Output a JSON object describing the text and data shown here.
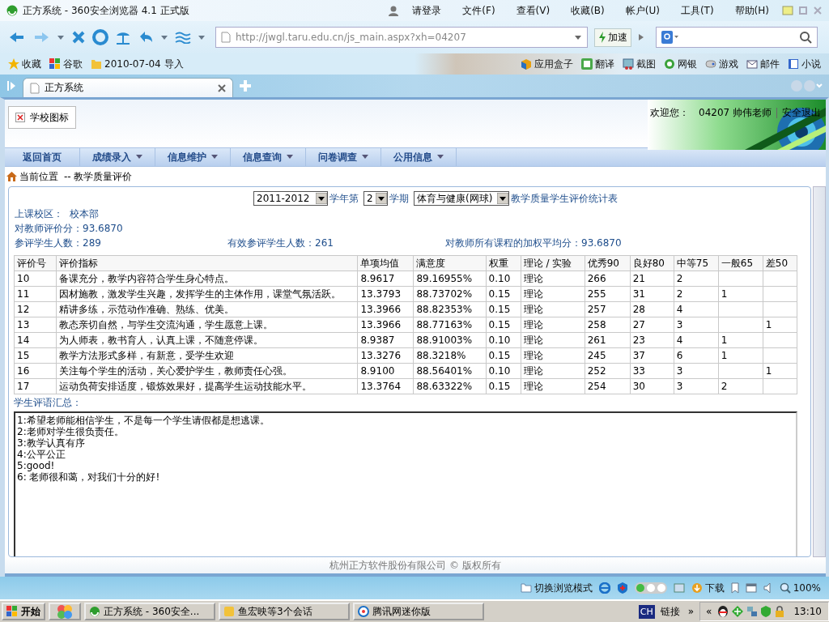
{
  "browser": {
    "title": "正方系统 - 360安全浏览器 4.1 正式版",
    "login": "请登录",
    "menu": [
      "文件(F)",
      "查看(V)",
      "收藏(B)",
      "帐户(U)",
      "工具(T)",
      "帮助(H)"
    ],
    "url": "http://jwgl.taru.edu.cn/js_main.aspx?xh=04207",
    "speed_button": "加速",
    "favorites": [
      "收藏",
      "谷歌",
      "2010-07-04 导入"
    ],
    "tools": [
      "应用盒子",
      "翻译",
      "截图",
      "网银",
      "游戏",
      "邮件",
      "小说"
    ],
    "tabs": [
      {
        "label": "正方系统",
        "selected": true
      }
    ]
  },
  "page": {
    "logo": "学校图标",
    "welcome": "欢迎您：",
    "user": "04207 帅伟老师",
    "logout": "安全退出",
    "nav": [
      {
        "label": "返回首页",
        "dropdown": false
      },
      {
        "label": "成绩录入",
        "dropdown": true
      },
      {
        "label": "信息维护",
        "dropdown": true
      },
      {
        "label": "信息查询",
        "dropdown": true
      },
      {
        "label": "问卷调查",
        "dropdown": true
      },
      {
        "label": "公用信息",
        "dropdown": true
      }
    ],
    "breadcrumb_label": "当前位置",
    "breadcrumb": "-- 教学质量评价",
    "filters": {
      "year": "2011-2012",
      "year_suffix": "学年第",
      "term": "2",
      "term_suffix": "学期",
      "course": "体育与健康(网球)",
      "report_title": "教学质量学生评价统计表"
    },
    "campus_label": "上课校区：",
    "campus": "校本部",
    "teacher_score": "对教师评价分：93.6870",
    "students": "参评学生人数：289",
    "valid_students": "有效参评学生人数：261",
    "weighted_avg": "对教师所有课程的加权平均分：93.6870",
    "table": {
      "columns": [
        "评价号",
        "评价指标",
        "单项均值",
        "满意度",
        "权重",
        "理论 / 实验",
        "优秀90",
        "良好80",
        "中等75",
        "一般65",
        "差50"
      ],
      "rows": [
        [
          "10",
          "备课充分，教学内容符合学生身心特点。",
          "8.9617",
          "89.16955%",
          "0.10",
          "理论",
          "266",
          "21",
          "2",
          "",
          ""
        ],
        [
          "11",
          "因材施教，激发学生兴趣，发挥学生的主体作用，课堂气氛活跃。",
          "13.3793",
          "88.73702%",
          "0.15",
          "理论",
          "255",
          "31",
          "2",
          "1",
          ""
        ],
        [
          "12",
          "精讲多练，示范动作准确、熟练、优美。",
          "13.3966",
          "88.82353%",
          "0.15",
          "理论",
          "257",
          "28",
          "4",
          "",
          ""
        ],
        [
          "13",
          "教态亲切自然，与学生交流沟通，学生愿意上课。",
          "13.3966",
          "88.77163%",
          "0.15",
          "理论",
          "258",
          "27",
          "3",
          "",
          "1"
        ],
        [
          "14",
          "为人师表，教书育人，认真上课，不随意停课。",
          "8.9387",
          "88.91003%",
          "0.10",
          "理论",
          "261",
          "23",
          "4",
          "1",
          ""
        ],
        [
          "15",
          "教学方法形式多样，有新意，受学生欢迎",
          "13.3276",
          "88.3218%",
          "0.15",
          "理论",
          "245",
          "37",
          "6",
          "1",
          ""
        ],
        [
          "16",
          "关注每个学生的活动，关心爱护学生，教师责任心强。",
          "8.9100",
          "88.56401%",
          "0.10",
          "理论",
          "252",
          "33",
          "3",
          "",
          "1"
        ],
        [
          "17",
          "运动负荷安排适度，锻炼效果好，提高学生运动技能水平。",
          "13.3764",
          "88.63322%",
          "0.15",
          "理论",
          "254",
          "30",
          "3",
          "2",
          ""
        ]
      ]
    },
    "comments_label": "学生评语汇总：",
    "comments": [
      "1:希望老师能相信学生，不是每一个学生请假都是想逃课。",
      "2:老师对学生很负责任。",
      "3:教学认真有序",
      "4:公平公正",
      "5:good!",
      "6: 老师很和蔼，对我们十分的好!"
    ],
    "footer": "杭州正方软件股份有限公司 © 版权所有"
  },
  "status_bar": {
    "mode": "切换浏览模式",
    "download": "下载",
    "zoom": "100%"
  },
  "taskbar": {
    "start": "开始",
    "tasks": [
      "正方系统 - 360安全...",
      "鱼宏映等3个会话",
      "腾讯网迷你版"
    ],
    "language": "CH",
    "links": "链接",
    "more": "»",
    "expand": "«",
    "clock": "13:10"
  }
}
